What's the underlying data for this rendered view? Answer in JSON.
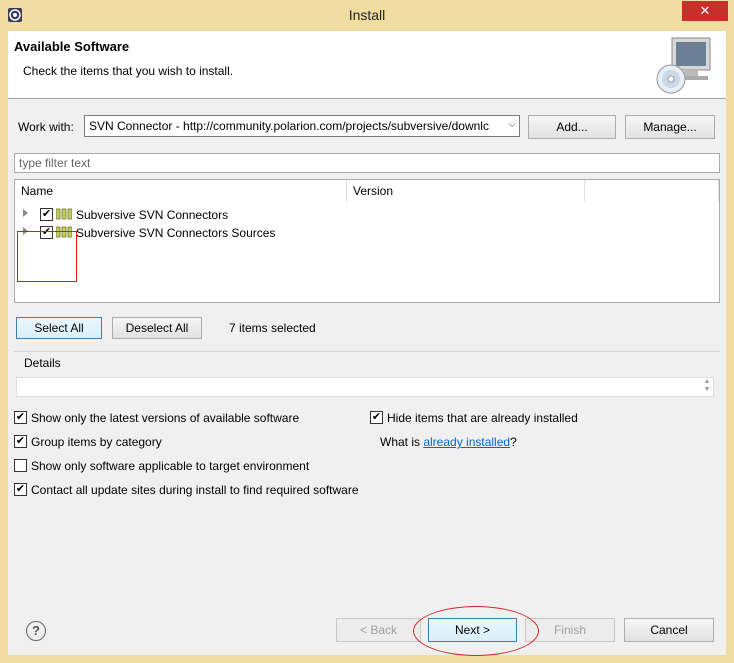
{
  "window": {
    "title": "Install",
    "close_label": "✕"
  },
  "header": {
    "title": "Available Software",
    "description": "Check the items that you wish to install."
  },
  "work_with": {
    "label": "Work with:",
    "value": "SVN Connector - http://community.polarion.com/projects/subversive/downlc",
    "add_label": "Add...",
    "manage_label": "Manage..."
  },
  "filter": {
    "placeholder": "type filter text"
  },
  "tree": {
    "columns": [
      "Name",
      "Version"
    ],
    "items": [
      {
        "label": "Subversive SVN Connectors",
        "checked": true
      },
      {
        "label": "Subversive SVN Connectors Sources",
        "checked": true
      }
    ]
  },
  "selection": {
    "select_all_label": "Select All",
    "deselect_all_label": "Deselect All",
    "count_text": "7 items selected"
  },
  "details": {
    "label": "Details"
  },
  "options": {
    "show_latest": {
      "label": "Show only the latest versions of available software",
      "checked": true
    },
    "hide_installed": {
      "label": "Hide items that are already installed",
      "checked": true
    },
    "group_by_category": {
      "label": "Group items by category",
      "checked": true
    },
    "what_is_prefix": "What is ",
    "what_is_link": "already installed",
    "what_is_suffix": "?",
    "target_env": {
      "label": "Show only software applicable to target environment",
      "checked": false
    },
    "contact_sites": {
      "label": "Contact all update sites during install to find required software",
      "checked": true
    }
  },
  "footer": {
    "back_label": "< Back",
    "next_label": "Next >",
    "finish_label": "Finish",
    "cancel_label": "Cancel"
  },
  "colors": {
    "title_bar": "#efdda2",
    "close_button": "#c7302a",
    "annotation": "#e0161e",
    "link": "#0066cc"
  }
}
